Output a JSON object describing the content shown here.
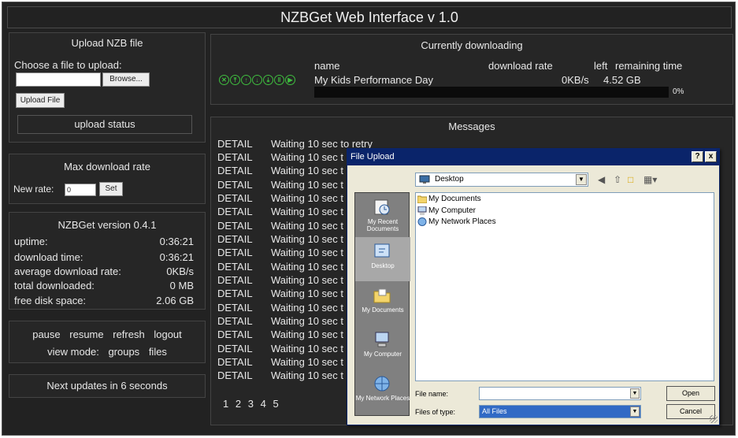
{
  "header": {
    "title": "NZBGet Web Interface v 1.0"
  },
  "upload": {
    "title": "Upload NZB file",
    "choose_label": "Choose a file to upload:",
    "browse_label": "Browse...",
    "upload_button": "Upload File",
    "status_label": "upload status"
  },
  "rate": {
    "title": "Max download rate",
    "new_rate_label": "New rate:",
    "new_rate_value": "0",
    "set_label": "Set"
  },
  "version": {
    "title": "NZBGet version 0.4.1",
    "stats": [
      {
        "label": "uptime:",
        "value": "0:36:21"
      },
      {
        "label": "download time:",
        "value": "0:36:21"
      },
      {
        "label": "average download rate:",
        "value": "0KB/s"
      },
      {
        "label": "total downloaded:",
        "value": "0 MB"
      },
      {
        "label": "free disk space:",
        "value": "2.06 GB"
      }
    ]
  },
  "controls": {
    "pause": "pause",
    "resume": "resume",
    "refresh": "refresh",
    "logout": "logout",
    "view_mode": "view mode:",
    "groups": "groups",
    "files": "files"
  },
  "next_update": "Next updates in 6 seconds",
  "downloading": {
    "title": "Currently downloading",
    "col_name": "name",
    "col_rate": "download rate",
    "col_left": "left",
    "col_remaining": "remaining time",
    "item": {
      "name": "My Kids Performance Day",
      "rate": "0KB/s",
      "left": "4.52 GB",
      "progress_text": "0%",
      "progress": 0
    },
    "icons": [
      "cancel-icon",
      "move-top-icon",
      "move-up-icon",
      "move-down-icon",
      "move-bottom-icon",
      "pause-icon",
      "resume-icon"
    ]
  },
  "messages": {
    "title": "Messages",
    "rows": [
      {
        "level": "DETAIL",
        "text": "Waiting 10 sec to retry"
      },
      {
        "level": "DETAIL",
        "text": "Waiting 10 sec t"
      },
      {
        "level": "DETAIL",
        "text": "Waiting 10 sec t"
      },
      {
        "level": "DETAIL",
        "text": "Waiting 10 sec t"
      },
      {
        "level": "DETAIL",
        "text": "Waiting 10 sec t"
      },
      {
        "level": "DETAIL",
        "text": "Waiting 10 sec t"
      },
      {
        "level": "DETAIL",
        "text": "Waiting 10 sec t"
      },
      {
        "level": "DETAIL",
        "text": "Waiting 10 sec t"
      },
      {
        "level": "DETAIL",
        "text": "Waiting 10 sec t"
      },
      {
        "level": "DETAIL",
        "text": "Waiting 10 sec t"
      },
      {
        "level": "DETAIL",
        "text": "Waiting 10 sec t"
      },
      {
        "level": "DETAIL",
        "text": "Waiting 10 sec t"
      },
      {
        "level": "DETAIL",
        "text": "Waiting 10 sec t"
      },
      {
        "level": "DETAIL",
        "text": "Waiting 10 sec t"
      },
      {
        "level": "DETAIL",
        "text": "Waiting 10 sec t"
      },
      {
        "level": "DETAIL",
        "text": "Waiting 10 sec t"
      },
      {
        "level": "DETAIL",
        "text": "Waiting 10 sec t"
      },
      {
        "level": "DETAIL",
        "text": "Waiting 10 sec t"
      }
    ],
    "pages": [
      "1",
      "2",
      "3",
      "4",
      "5"
    ]
  },
  "dialog": {
    "title": "File Upload",
    "help": "?",
    "close": "x",
    "look_in": "Desktop",
    "places": [
      "My Recent Documents",
      "Desktop",
      "My Documents",
      "My Computer",
      "My Network Places"
    ],
    "files": [
      "My Documents",
      "My Computer",
      "My Network Places"
    ],
    "file_name_label": "File name:",
    "file_name_value": "",
    "file_type_label": "Files of type:",
    "file_type_value": "All Files",
    "open": "Open",
    "cancel": "Cancel"
  },
  "colors": {
    "background": "#222222",
    "accent": "#3fbf3f",
    "dialog_title": "#0a246a",
    "dialog_face": "#ece9d8"
  }
}
